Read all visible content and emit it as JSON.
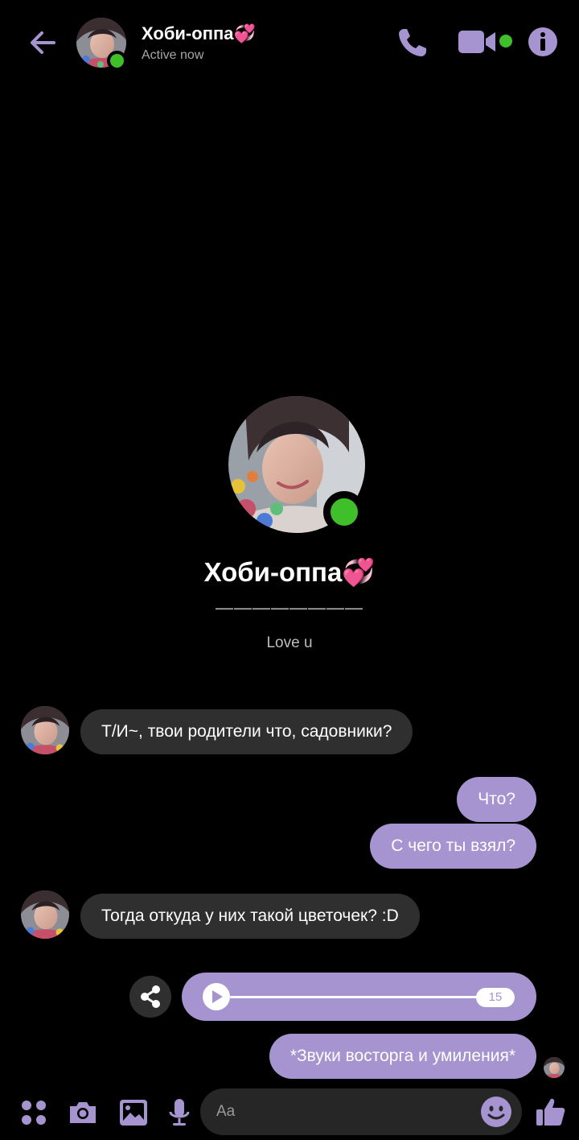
{
  "header": {
    "name": "Хоби-оппа💞",
    "status": "Active now"
  },
  "profile": {
    "name": "Хоби-оппа💞",
    "subtitle": "————————",
    "bio": "Love u"
  },
  "messages": [
    {
      "direction": "in",
      "text": "Т/И~, твои родители что, садовники?"
    },
    {
      "direction": "out",
      "text": "Что?"
    },
    {
      "direction": "out",
      "text": "С чего ты взял?"
    },
    {
      "direction": "in",
      "text": "Тогда откуда у них такой цветочек? :D"
    },
    {
      "direction": "out",
      "type": "audio",
      "duration": "15"
    },
    {
      "direction": "out",
      "text": "*Звуки восторга и умиления*"
    }
  ],
  "composer": {
    "placeholder": "Aa"
  },
  "colors": {
    "accent": "#a594cf",
    "incoming_bubble": "#2f2f2f",
    "online": "#3fbf2a",
    "background": "#000000"
  },
  "icons": [
    "back-arrow-icon",
    "phone-icon",
    "video-camera-icon",
    "info-icon",
    "share-icon",
    "play-icon",
    "apps-icon",
    "camera-icon",
    "image-icon",
    "microphone-icon",
    "emoji-icon",
    "thumbs-up-icon"
  ]
}
